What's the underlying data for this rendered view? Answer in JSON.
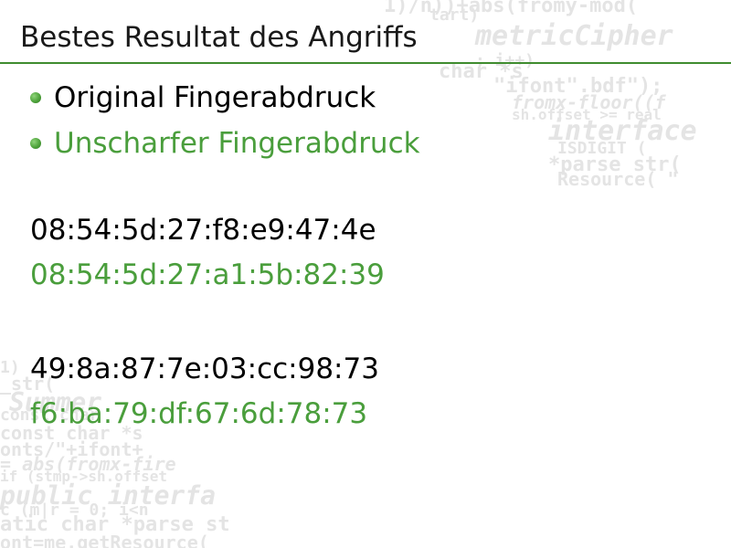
{
  "slide": {
    "title": "Bestes Resultat des Angriffs"
  },
  "legend": {
    "items": [
      {
        "label": "Original Fingerabdruck"
      },
      {
        "label": "Unscharfer Fingerabdruck"
      }
    ]
  },
  "fingerprints": [
    {
      "original": "08:54:5d:27:f8:e9:47:4e",
      "fuzzy": "08:54:5d:27:a1:5b:82:39"
    },
    {
      "original": "49:8a:87:7e:03:cc:98:73",
      "fuzzy": "f6:ba:79:df:67:6d:78:73"
    }
  ],
  "colors": {
    "original": "#000000",
    "fuzzy": "#4a9e3c",
    "accent_rule": "#3f8c2f"
  }
}
